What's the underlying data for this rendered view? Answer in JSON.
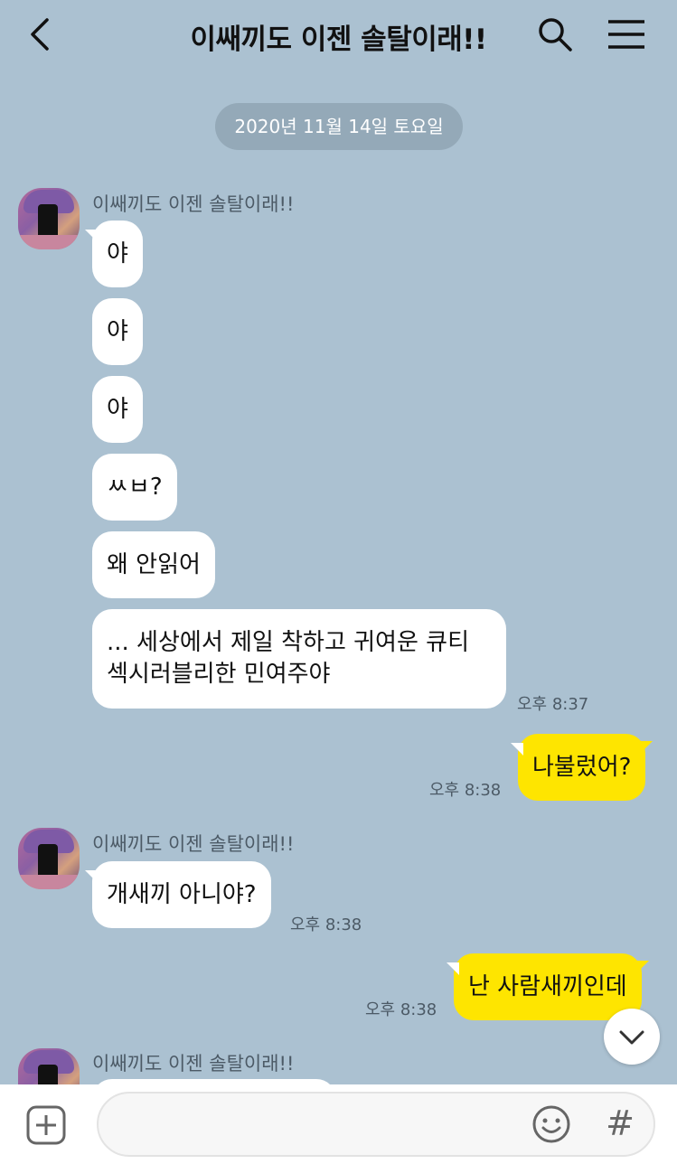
{
  "header": {
    "title": "이쌔끼도 이젠 솔탈이래!!",
    "back_icon": "chevron-left-icon",
    "search_icon": "search-icon",
    "menu_icon": "hamburger-menu-icon"
  },
  "date_divider": "2020년 11월 14일 토요일",
  "sender_name": "이쌔끼도 이젠 솔탈이래!!",
  "group1": {
    "messages": [
      "야",
      "야",
      "야",
      "ㅆㅂ?",
      "왜 안읽어"
    ],
    "long_message_line1": "... 세상에서 제일 착하고 귀여운 큐티",
    "long_message_line2": "섹시러블리한 민여주야",
    "time": "오후 8:37"
  },
  "my_message1": {
    "text": "나불렀어?",
    "time": "오후 8:38"
  },
  "group2": {
    "message": "개새끼 아니야?",
    "time": "오후 8:38"
  },
  "my_message2": {
    "text": "난 사람새끼인데",
    "time": "오후 8:38"
  },
  "input_bar": {
    "placeholder": "",
    "plus_icon": "plus-square-icon",
    "emoji_icon": "smiley-icon",
    "hash_label": "#"
  },
  "colors": {
    "background": "#abc1d1",
    "my_bubble": "#fee500",
    "their_bubble": "#ffffff",
    "date_pill": "#94a9b8"
  }
}
